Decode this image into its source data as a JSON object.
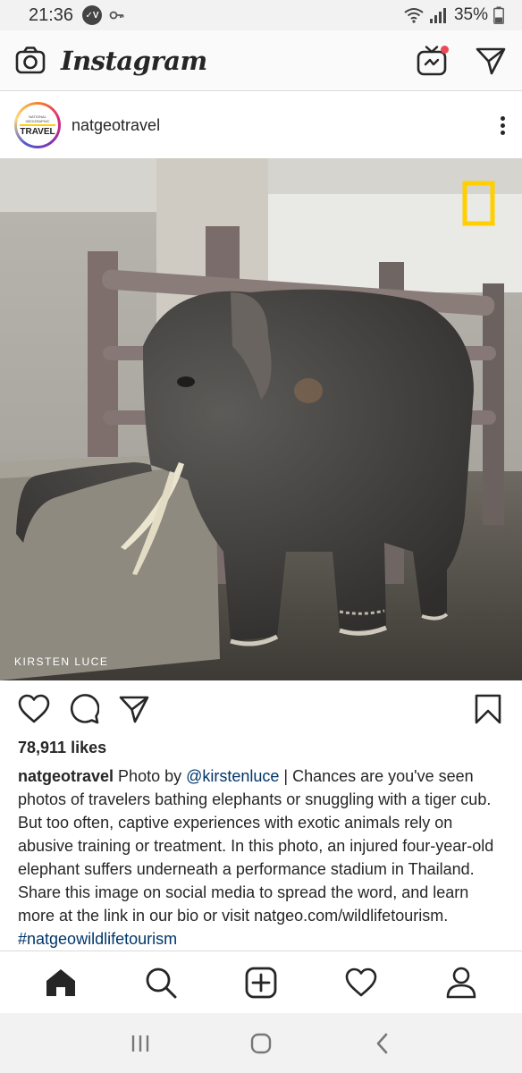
{
  "status_bar": {
    "time": "21:36",
    "battery": "35%",
    "icons": [
      "vpn-badge-icon",
      "key-icon",
      "wifi-icon",
      "signal-icon",
      "battery-icon"
    ]
  },
  "header": {
    "logo": "Instagram",
    "icons": [
      "camera-icon",
      "igtv-icon",
      "direct-message-icon"
    ],
    "notification_color": "#ed4956"
  },
  "post": {
    "username": "natgeotravel",
    "avatar": {
      "small_text": "NATIONAL GEOGRAPHIC",
      "label": "TRAVEL"
    },
    "photo": {
      "credit": "KIRSTEN LUCE",
      "logo_color": "#ffcf00"
    },
    "likes": "78,911 likes",
    "caption": {
      "user": "natgeotravel",
      "pre": " Photo by ",
      "mention": "@kirstenluce",
      "body": " | Chances are you've seen photos of travelers bathing elephants or snuggling with a tiger cub. But too often, captive experiences with exotic animals rely on abusive training or treatment. In this photo, an injured four-year-old elephant suffers underneath a performance stadium in Thailand. Share this image on social media to spread the word, and learn more at the link in our bio or visit natgeo.com/wildlifetourism. ",
      "hashtag": "#natgeowildlifetourism"
    }
  },
  "bottom_nav": [
    "home-icon",
    "search-icon",
    "new-post-icon",
    "activity-heart-icon",
    "profile-icon"
  ],
  "android_nav": [
    "recent-apps-icon",
    "home-circle-icon",
    "back-icon"
  ],
  "colors": {
    "link": "#003569",
    "text": "#262626"
  }
}
